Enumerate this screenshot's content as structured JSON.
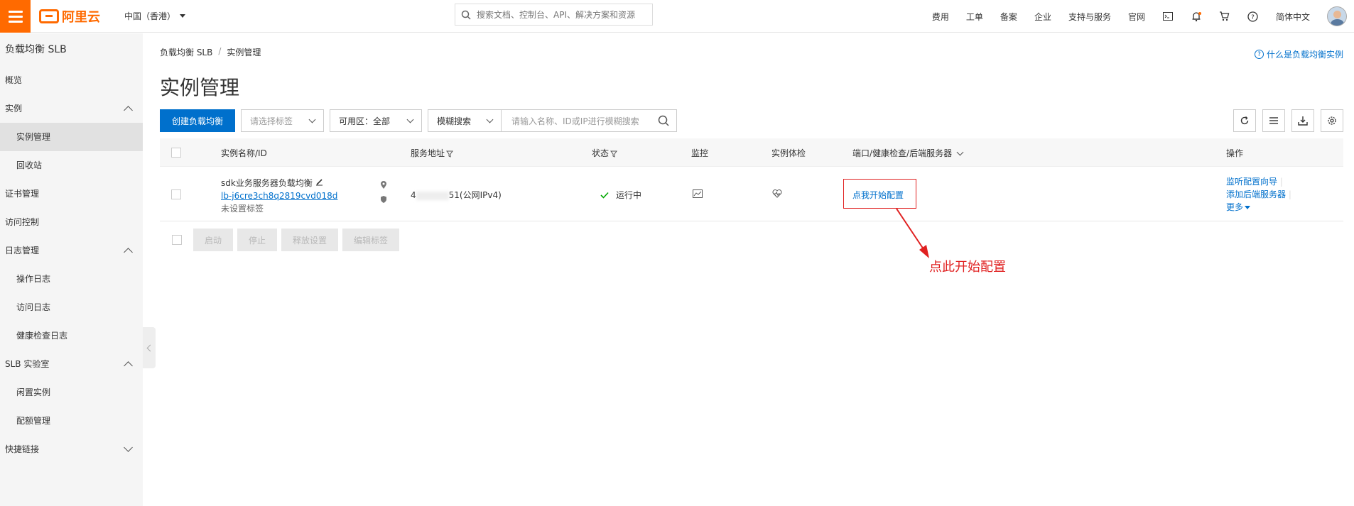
{
  "topbar": {
    "logo_text": "阿里云",
    "region": "中国（香港）",
    "search_placeholder": "搜索文档、控制台、API、解决方案和资源",
    "nav": [
      "费用",
      "工单",
      "备案",
      "企业",
      "支持与服务",
      "官网"
    ],
    "lang": "简体中文"
  },
  "sidebar": {
    "title": "负载均衡 SLB",
    "items": [
      {
        "label": "概览"
      },
      {
        "label": "实例"
      },
      {
        "label": "实例管理"
      },
      {
        "label": "回收站"
      },
      {
        "label": "证书管理"
      },
      {
        "label": "访问控制"
      },
      {
        "label": "日志管理"
      },
      {
        "label": "操作日志"
      },
      {
        "label": "访问日志"
      },
      {
        "label": "健康检查日志"
      },
      {
        "label": "SLB 实验室"
      },
      {
        "label": "闲置实例"
      },
      {
        "label": "配额管理"
      },
      {
        "label": "快捷链接"
      }
    ]
  },
  "breadcrumb": {
    "root": "负载均衡 SLB",
    "sep": "/",
    "current": "实例管理"
  },
  "help_link": "什么是负载均衡实例",
  "page_title": "实例管理",
  "toolbar": {
    "create_label": "创建负载均衡",
    "tag_placeholder": "请选择标签",
    "zone_label": "可用区：全部",
    "search_mode": "模糊搜索",
    "search_placeholder": "请输入名称、ID或IP进行模糊搜索"
  },
  "table": {
    "headers": {
      "name": "实例名称/ID",
      "address": "服务地址",
      "status": "状态",
      "monitor": "监控",
      "health": "实例体检",
      "ports": "端口/健康检查/后端服务器",
      "actions": "操作"
    },
    "rows": [
      {
        "name": "sdk业务服务器负载均衡",
        "id": "lb-j6cre3ch8q2819cvd018d",
        "tags": "未设置标签",
        "address_prefix": "4",
        "address_suffix": "51(公网IPv4)",
        "status": "运行中",
        "config_link": "点我开始配置",
        "actions": [
          "监听配置向导",
          "添加后端服务器",
          "更多"
        ]
      }
    ]
  },
  "bottom_actions": [
    "启动",
    "停止",
    "释放设置",
    "编辑标签"
  ],
  "annotation": {
    "text": "点此开始配置",
    "color": "#e02020"
  },
  "colors": {
    "brand": "#ff6a00",
    "primary": "#0070cc",
    "success": "#00a700"
  }
}
